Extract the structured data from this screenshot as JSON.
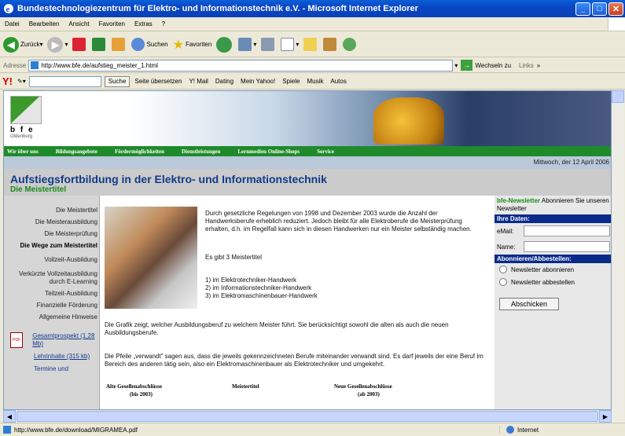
{
  "window": {
    "title": "Bundestechnologiezentrum für Elektro- und Informationstechnik e.V. - Microsoft Internet Explorer"
  },
  "menu": [
    "Datei",
    "Bearbeiten",
    "Ansicht",
    "Favoriten",
    "Extras",
    "?"
  ],
  "toolbar": {
    "back": "Zurück",
    "search": "Suchen",
    "favorites": "Favoriten"
  },
  "address": {
    "label": "Adresse",
    "url": "http://www.bfe.de/aufstieg_meister_1.html",
    "go": "Wechseln zu",
    "links": "Links"
  },
  "ybar": {
    "search_btn": "Suche",
    "items": [
      "Seite übersetzen",
      "Y! Mail",
      "Dating",
      "Mein Yahoo!",
      "Spiele",
      "Musik",
      "Autos"
    ]
  },
  "site": {
    "logo": "b f e",
    "logo_city": "Oldenburg",
    "nav": [
      "Wir über uns",
      "Bildungsangebote",
      "Fördermöglichkeiten",
      "Dienstleistungen",
      "Lernmedien Online-Shops",
      "Service"
    ],
    "date": "Mittwoch, der 12 April 2006",
    "heading": "Aufstiegsfortbildung in der Elektro- und Informationstechnik",
    "subheading": "Die Meistertitel",
    "left_menu": [
      "Die Meistertitel",
      "Die Meisterausbildung",
      "Die Meisterprüfung",
      "Die Wege zum Meistertitel",
      "Vollzeit-Ausbildung",
      "Verkürzte Vollzeitausbildung durch E-Learning",
      "Teilzeit-Ausbildung",
      "Finanzielle Förderung",
      "Allgemeine Hinweise"
    ],
    "downloads": [
      "Gesamtprospekt (1,28 Mb)",
      "Lehrinhalte (315 kb)",
      "Termine und"
    ],
    "p1": "Durch gesetzliche Regelungen von 1998 und Dezember 2003 wurde die Anzahl der Handwerksberufe erheblich reduziert. Jedoch bleibt für alle Elektroberufe die Meisterprüfung erhalten, d.h. im Regelfall kann sich in diesen Handwerken nur ein Meister selbständig machen.",
    "p2": "Es gibt 3 Meistertitel",
    "list": [
      "1) im Elektrotechniker-Handwerk",
      "2) im Informationstechniker-Handwerk",
      "3) im Elektromaschinenbauer-Handwerk"
    ],
    "p3": "Die Grafik zeigt, welcher Ausbildungsberuf zu welchem Meister führt. Sie berücksichtigt sowohl die alten als auch die neuen Ausbildungsberufe.",
    "p4": "Die Pfeile „verwandt\" sagen aus, dass die jeweils gekennzeichneten Berufe miteinander verwandt sind. Es darf jeweils der eine Beruf im Bereich des anderen tätig sein, also ein Elektromaschinenbauer als Elektrotechniker und umgekehrt.",
    "table": {
      "c1": "Alte Gesellenabschlüsse",
      "c1b": "(bis 2003)",
      "c2": "Meistertitel",
      "c3": "Neue Gesellenabschlüsse",
      "c3b": "(ab 2003)"
    },
    "newsletter": {
      "title": "bfe-Newsletter",
      "intro": "Abonnieren Sie unseren Newsletter",
      "your_data": "Ihre Daten:",
      "email": "eMail:",
      "name": "Name:",
      "action": "Abonnieren/Abbestellen:",
      "opt1": "Newsletter abonnieren",
      "opt2": "Newsletter abbestellen",
      "submit": "Abschicken"
    }
  },
  "status": {
    "text": "http://www.bfe.de/download/MIGRAMEA.pdf",
    "zone": "Internet"
  }
}
